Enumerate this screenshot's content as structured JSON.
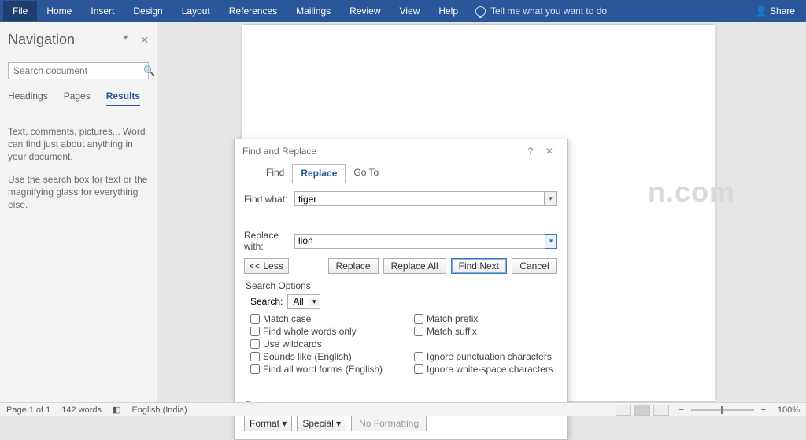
{
  "ribbon": {
    "tabs": [
      "File",
      "Home",
      "Insert",
      "Design",
      "Layout",
      "References",
      "Mailings",
      "Review",
      "View",
      "Help"
    ],
    "tell_me": "Tell me what you want to do",
    "share": "Share"
  },
  "nav": {
    "title": "Navigation",
    "dd": "▾",
    "close": "✕",
    "search_placeholder": "Search document",
    "mag": "🔍",
    "search_dd": "▾",
    "tabs": {
      "headings": "Headings",
      "pages": "Pages",
      "results": "Results"
    },
    "msg1": "Text, comments, pictures... Word can find just about anything in your document.",
    "msg2": "Use the search box for text or the magnifying glass for everything else."
  },
  "watermark": "n.com",
  "dialog": {
    "title": "Find and Replace",
    "help": "?",
    "close": "✕",
    "tabs": {
      "find": "Find",
      "replace": "Replace",
      "goto": "Go To"
    },
    "find_label": "Find what:",
    "find_value": "tiger",
    "replace_label": "Replace with:",
    "replace_value": "lion",
    "dd": "▾",
    "buttons": {
      "less": "<< Less",
      "replace": "Replace",
      "replace_all": "Replace All",
      "find_next": "Find Next",
      "cancel": "Cancel"
    },
    "search_options": "Search Options",
    "search_lbl": "Search:",
    "search_dir": "All",
    "chk": {
      "match_case": "Match case",
      "whole_words": "Find whole words only",
      "wildcards": "Use wildcards",
      "sounds_like": "Sounds like (English)",
      "word_forms": "Find all word forms (English)",
      "match_prefix": "Match prefix",
      "match_suffix": "Match suffix",
      "ignore_punct": "Ignore punctuation characters",
      "ignore_ws": "Ignore white-space characters"
    },
    "replace_section": "Replace",
    "footer": {
      "format": "Format",
      "special": "Special",
      "noformat": "No Formatting"
    }
  },
  "status": {
    "page": "Page 1 of 1",
    "words": "142 words",
    "lang": "English (India)",
    "zoom_minus": "−",
    "zoom_plus": "+",
    "zoom": "100%"
  }
}
